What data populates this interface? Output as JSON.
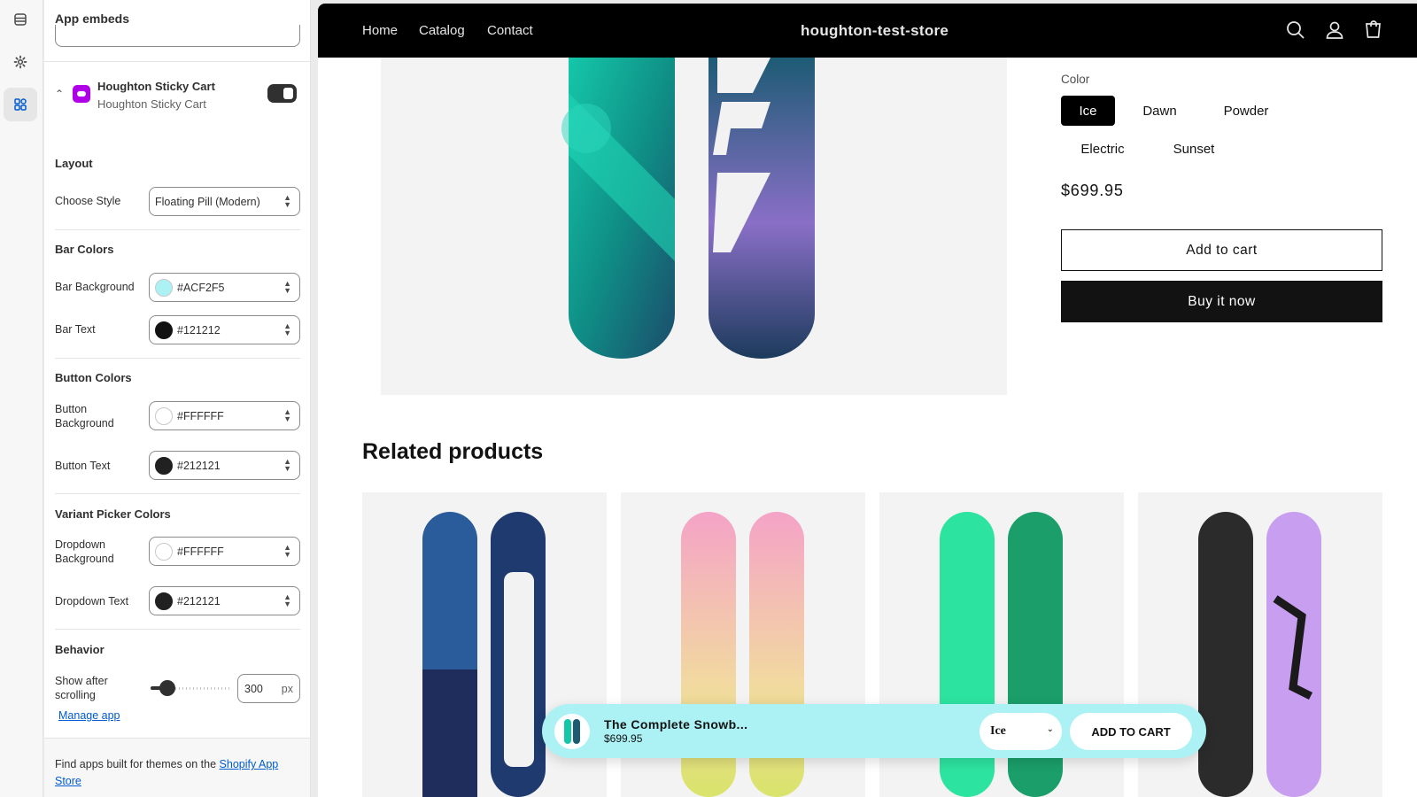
{
  "panel": {
    "title": "App embeds",
    "embed": {
      "name": "Houghton Sticky Cart",
      "subtitle": "Houghton Sticky Cart",
      "enabled": true
    },
    "layout": {
      "title": "Layout",
      "style_label": "Choose Style",
      "style_value": "Floating Pill (Modern)"
    },
    "bar_colors": {
      "title": "Bar Colors",
      "background_label": "Bar Background",
      "background_value": "#ACF2F5",
      "background_color": "#ACF2F5",
      "text_label": "Bar Text",
      "text_value": "#121212",
      "text_color": "#121212"
    },
    "button_colors": {
      "title": "Button Colors",
      "background_label": "Button Background",
      "background_value": "#FFFFFF",
      "background_color": "#FFFFFF",
      "text_label": "Button Text",
      "text_value": "#212121",
      "text_color": "#212121"
    },
    "variant_colors": {
      "title": "Variant Picker Colors",
      "background_label": "Dropdown Background",
      "background_value": "#FFFFFF",
      "background_color": "#FFFFFF",
      "text_label": "Dropdown Text",
      "text_value": "#212121",
      "text_color": "#212121"
    },
    "behavior": {
      "title": "Behavior",
      "scroll_label": "Show after scrolling",
      "scroll_value": "300",
      "scroll_unit": "px"
    },
    "manage_link": "Manage app",
    "footer": {
      "text": "Find apps built for themes on the ",
      "link": "Shopify App Store"
    }
  },
  "store": {
    "nav": [
      "Home",
      "Catalog",
      "Contact"
    ],
    "name": "houghton-test-store",
    "icons": [
      "search-icon",
      "account-icon",
      "cart-icon"
    ],
    "color_label": "Color",
    "colors": [
      "Ice",
      "Dawn",
      "Powder",
      "Electric",
      "Sunset"
    ],
    "selected_color": "Ice",
    "price": "$699.95",
    "add_to_cart": "Add to cart",
    "buy_now": "Buy it now",
    "related_title": "Related products"
  },
  "sticky": {
    "title": "The Complete Snowb...",
    "price": "$699.95",
    "variant": "Ice",
    "button": "ADD TO CART",
    "background": "#ACF2F5"
  }
}
